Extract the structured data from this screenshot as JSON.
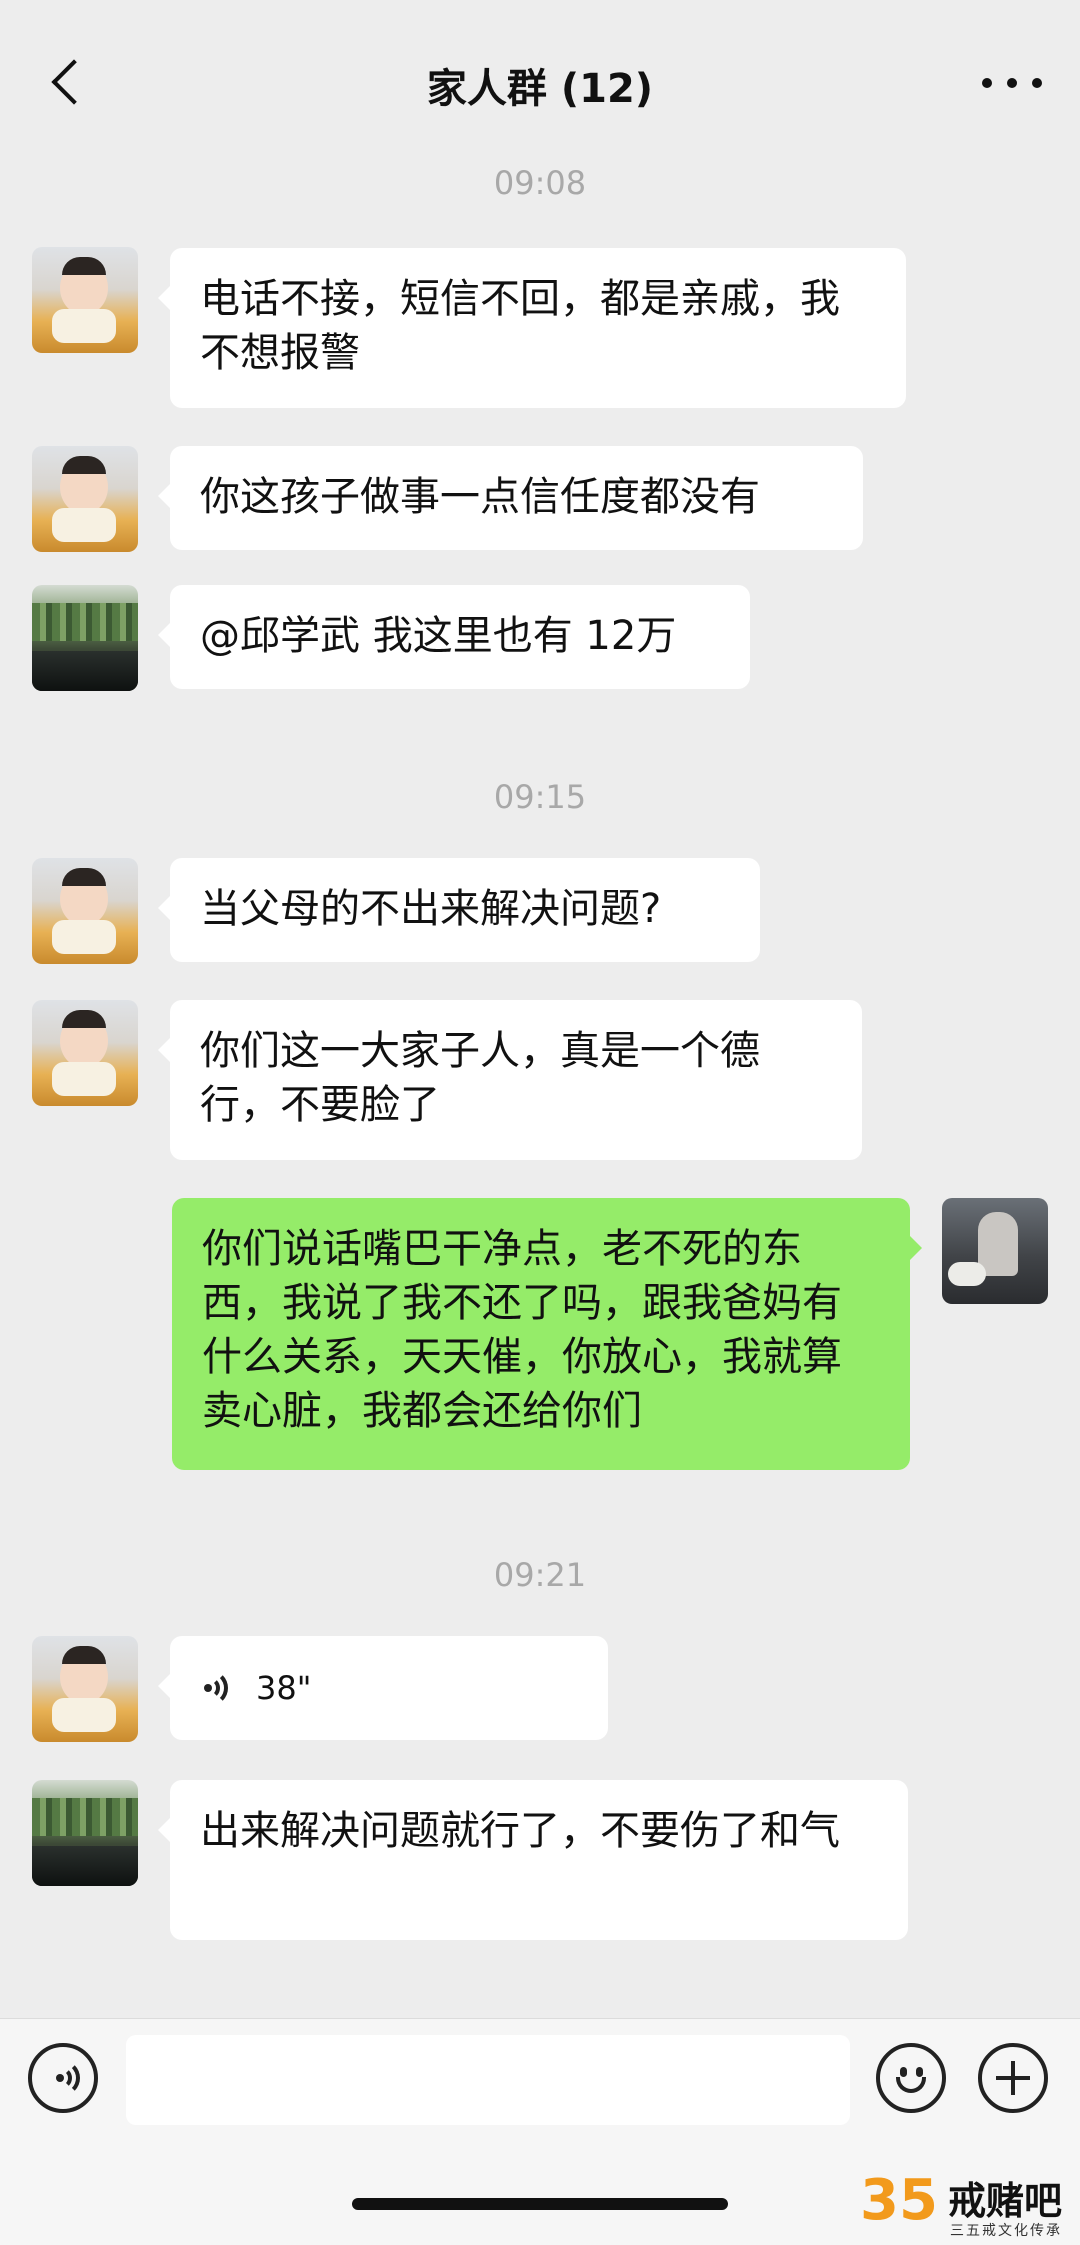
{
  "header": {
    "title": "家人群 (12)"
  },
  "messages": {
    "t1": "09:08",
    "m1": "电话不接，短信不回，都是亲戚，我不想报警",
    "m2": "你这孩子做事一点信任度都没有",
    "m3": "@邱学武 我这里也有 12万",
    "t2": "09:15",
    "m4": "当父母的不出来解决问题?",
    "m5": "你们这一大家子人，真是一个德行，不要脸了",
    "m6": "你们说话嘴巴干净点，老不死的东西，我说了我不还了吗，跟我爸妈有什么关系，天天催，你放心，我就算卖心脏，我都会还给你们",
    "t3": "09:21",
    "voice_duration": "38\"",
    "m7": "出来解决问题就行了，不要伤了和气"
  },
  "watermark": {
    "logo": "35",
    "title": "戒赌吧",
    "subtitle": "三五戒文化传承"
  },
  "colors": {
    "background": "#ededed",
    "bubble_incoming": "#ffffff",
    "bubble_outgoing": "#95ec69",
    "timestamp": "#a8a8a8"
  }
}
